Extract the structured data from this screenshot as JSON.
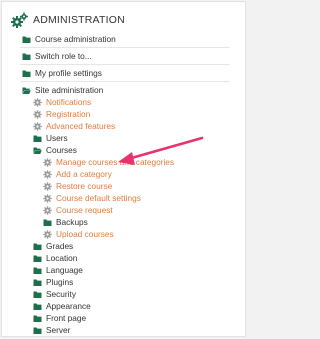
{
  "header": {
    "title": "ADMINISTRATION",
    "icon": "gears-icon"
  },
  "colors": {
    "link": "#e07d3c",
    "text": "#333333",
    "folder": "#1f6e4c",
    "gear": "#999999",
    "arrow": "#e8336d"
  },
  "sections": [
    {
      "label": "Course administration",
      "icon": "folder-icon"
    },
    {
      "label": "Switch role to...",
      "icon": "folder-icon"
    },
    {
      "label": "My profile settings",
      "icon": "folder-icon"
    }
  ],
  "site_admin": {
    "label": "Site administration",
    "items": [
      {
        "label": "Notifications",
        "icon": "gear-icon",
        "kind": "link"
      },
      {
        "label": "Registration",
        "icon": "gear-icon",
        "kind": "link"
      },
      {
        "label": "Advanced features",
        "icon": "gear-icon",
        "kind": "link"
      },
      {
        "label": "Users",
        "icon": "folder-icon",
        "kind": "folder"
      },
      {
        "label": "Courses",
        "icon": "folder-open-icon",
        "kind": "folder"
      }
    ],
    "courses_items": [
      {
        "label": "Manage courses and categories",
        "icon": "gear-icon",
        "kind": "link"
      },
      {
        "label": "Add a category",
        "icon": "gear-icon",
        "kind": "link"
      },
      {
        "label": "Restore course",
        "icon": "gear-icon",
        "kind": "link"
      },
      {
        "label": "Course default settings",
        "icon": "gear-icon",
        "kind": "link"
      },
      {
        "label": "Course request",
        "icon": "gear-icon",
        "kind": "link"
      },
      {
        "label": "Backups",
        "icon": "folder-icon",
        "kind": "folder"
      },
      {
        "label": "Upload courses",
        "icon": "gear-icon",
        "kind": "link"
      }
    ],
    "more_items": [
      {
        "label": "Grades",
        "icon": "folder-icon",
        "kind": "folder"
      },
      {
        "label": "Location",
        "icon": "folder-icon",
        "kind": "folder"
      },
      {
        "label": "Language",
        "icon": "folder-icon",
        "kind": "folder"
      },
      {
        "label": "Plugins",
        "icon": "folder-icon",
        "kind": "folder"
      },
      {
        "label": "Security",
        "icon": "folder-icon",
        "kind": "folder"
      },
      {
        "label": "Appearance",
        "icon": "folder-icon",
        "kind": "folder"
      },
      {
        "label": "Front page",
        "icon": "folder-icon",
        "kind": "folder"
      },
      {
        "label": "Server",
        "icon": "folder-icon",
        "kind": "folder"
      }
    ]
  }
}
